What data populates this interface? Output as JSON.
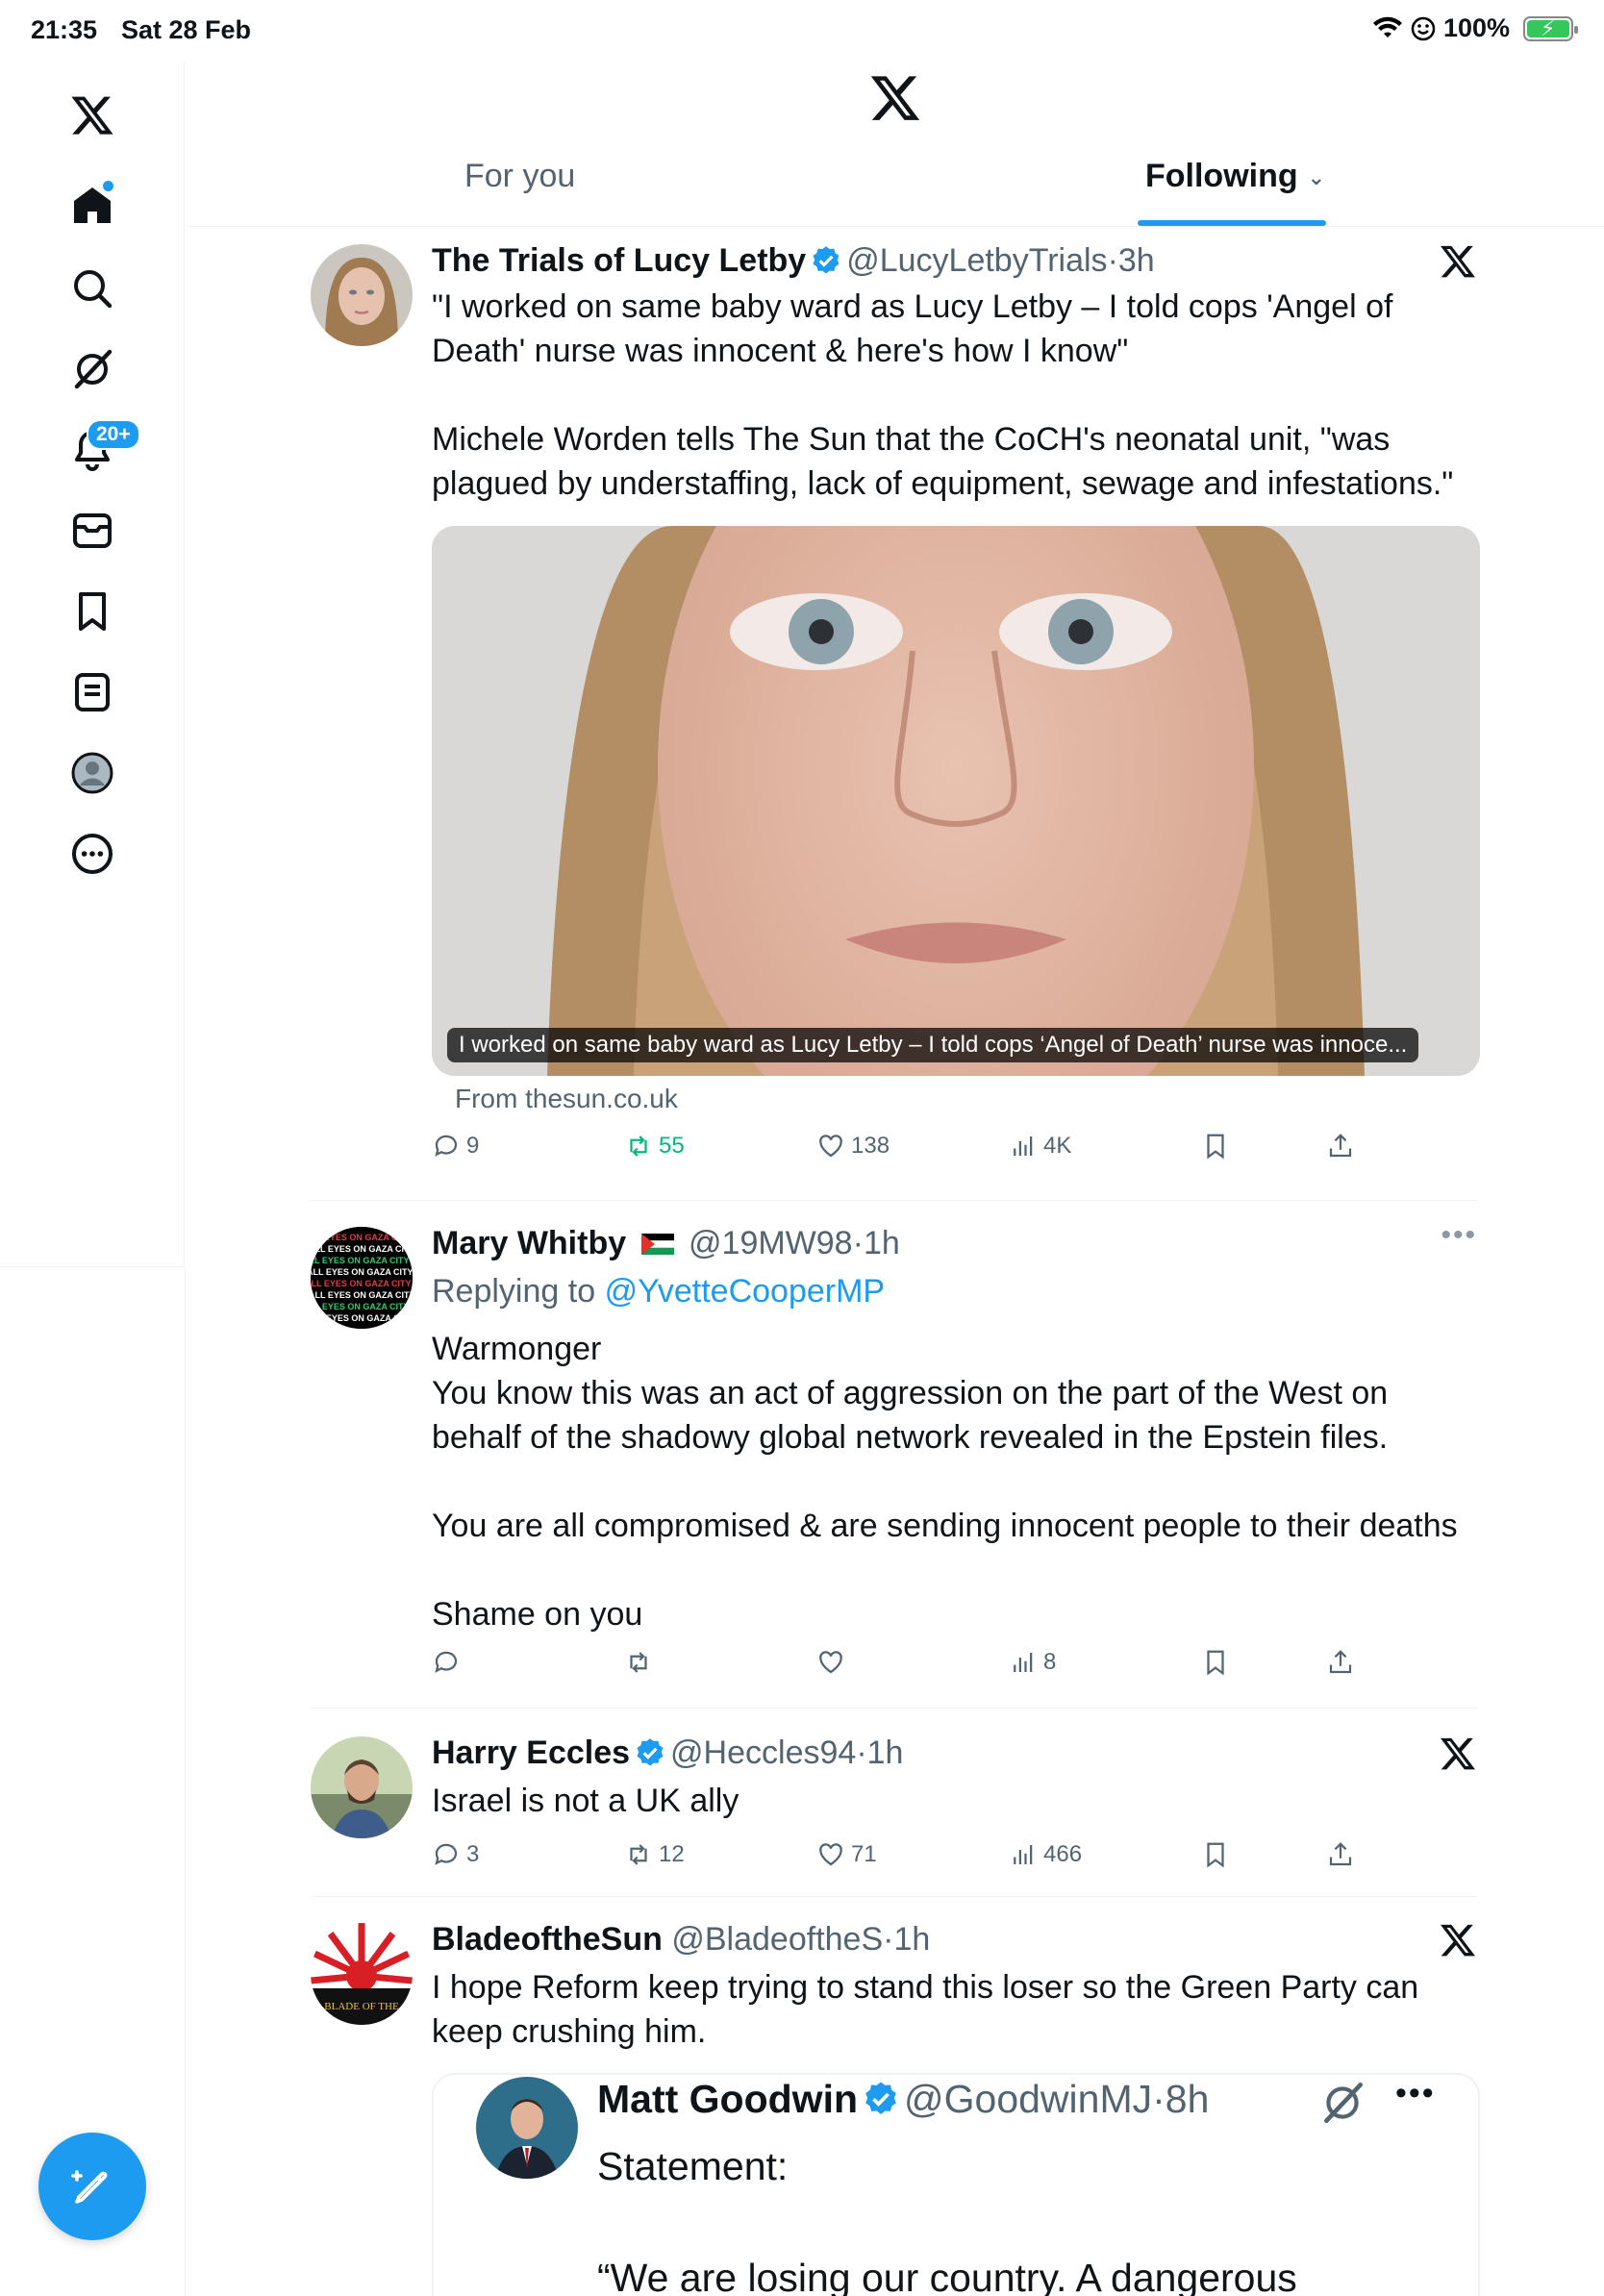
{
  "status_bar": {
    "time": "21:35",
    "date": "Sat 28 Feb",
    "battery": "100%"
  },
  "sidebar": {
    "notifications_badge": "20+"
  },
  "header": {
    "tabs": [
      {
        "label": "For you"
      },
      {
        "label": "Following"
      }
    ]
  },
  "tweets": [
    {
      "name": "The Trials of Lucy Letby",
      "handle": "@LucyLetbyTrials",
      "sep": "·",
      "time": "3h",
      "text": "\"I worked on same baby ward as Lucy Letby – I told cops 'Angel of Death' nurse was innocent & here's how I know\"\n\nMichele Worden tells The Sun that the CoCH's neonatal unit, \"was plagued by understaffing, lack of equipment, sewage and infestations.\"",
      "card_caption": "I worked on same baby ward as Lucy Letby – I told cops ‘Angel of Death’ nurse was innoce...",
      "card_source": "From thesun.co.uk",
      "replies": "9",
      "reposts": "55",
      "likes": "138",
      "views": "4K"
    },
    {
      "name": "Mary Whitby",
      "handle": "@19MW98",
      "sep": "·",
      "time": "1h",
      "replying_prefix": "Replying to",
      "replying_to": "@YvetteCooperMP",
      "text": "Warmonger\nYou know this was an act of aggression on the part of the West on behalf of the shadowy global network revealed in the Epstein files.\n\nYou are all compromised & are sending innocent people to their deaths\n\nShame on you",
      "replies": "",
      "reposts": "",
      "likes": "",
      "views": "8",
      "avatar_text": "ALL EYES ON GAZA CITY"
    },
    {
      "name": "Harry Eccles",
      "handle": "@Heccles94",
      "sep": "·",
      "time": "1h",
      "text": "Israel is not a UK ally",
      "replies": "3",
      "reposts": "12",
      "likes": "71",
      "views": "466"
    },
    {
      "name": "BladeoftheSun",
      "handle": "@BladeoftheS",
      "sep": "·",
      "time": "1h",
      "text": "I hope Reform keep trying to stand this loser so the Green Party can keep crushing him.",
      "avatar_text": "BLADE OF THE",
      "quote": {
        "name": "Matt Goodwin",
        "handle": "@GoodwinMJ",
        "sep": "·",
        "time": "8h",
        "text": "Statement:\n\n“We are losing our country. A dangerous"
      }
    }
  ],
  "colors": {
    "accent": "#1d9bf0",
    "repost_active": "#00ba7c",
    "text_secondary": "#536471"
  }
}
